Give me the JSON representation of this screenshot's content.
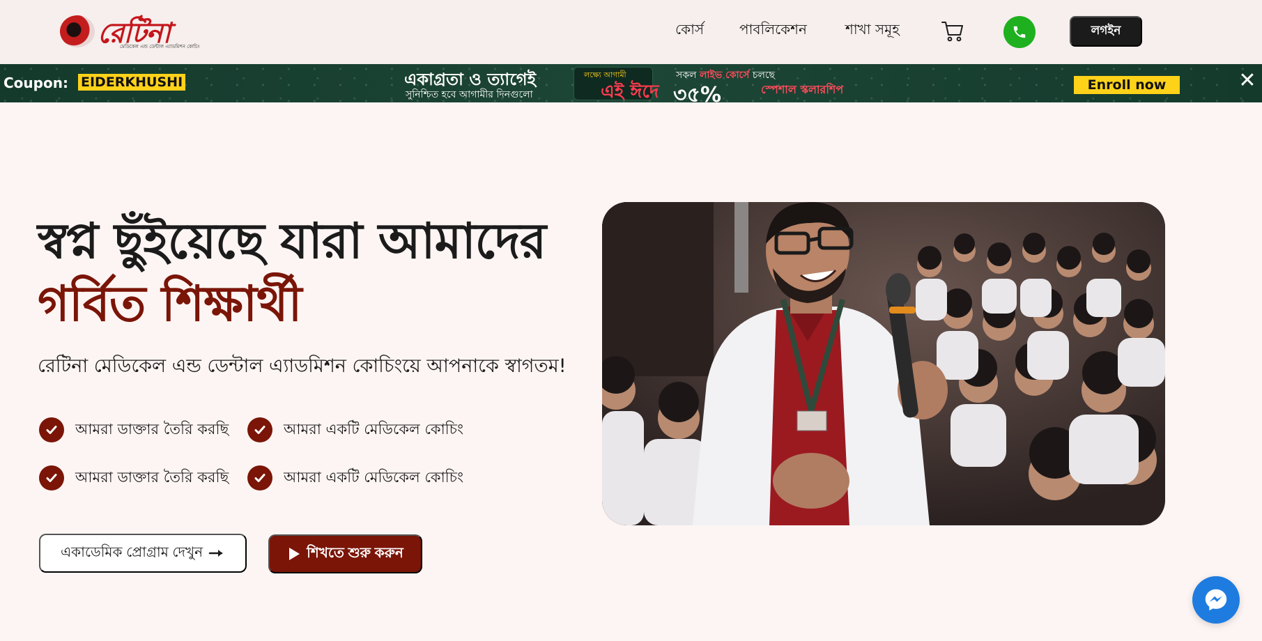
{
  "header": {
    "logo_text": "রেটিনা",
    "logo_subtitle": "মেডিকেল এন্ড ডেন্টাল এ্যাডমিশন কোচিং",
    "nav": [
      "কোর্স",
      "পাবলিকেশন",
      "শাখা সমূহ"
    ],
    "login_label": "লগইন"
  },
  "banner": {
    "coupon_label": "Coupon:",
    "coupon_code": "EIDERKHUSHI",
    "headline": "একাগ্রতা ও ত্যাগেই",
    "subheadline": "সুনিশ্চিত হবে আগামীর দিনগুলো",
    "eid_small": "লক্ষ্যে আগামী",
    "eid_big": "এই ঈদে",
    "live_text_pre": "সকল ",
    "live_text_hl": "লাইভ কোর্সে",
    "live_text_post": " চলছে",
    "discount": "৩৫%",
    "scholarship": "স্পেশাল স্কলারশিপ",
    "enroll_label": "Enroll now",
    "close_symbol": "✕"
  },
  "hero": {
    "title_line1": "স্বপ্ন ছুঁইয়েছে যারা আমাদের",
    "title_line2": "গর্বিত শিক্ষার্থী",
    "welcome": "রেটিনা মেডিকেল এন্ড ডেন্টাল এ্যাডমিশন কোচিংয়ে আপনাকে স্বাগতম!",
    "features": [
      "আমরা ডাক্তার তৈরি করছি",
      "আমরা একটি মেডিকেল কোচিং",
      "আমরা ডাক্তার তৈরি করছি",
      "আমরা একটি মেডিকেল কোচিং"
    ],
    "btn_academic": "একাডেমিক প্রোগ্রাম দেখুন",
    "btn_start": "শিখতে শুরু করুন"
  },
  "colors": {
    "brand_red": "#c4161c",
    "accent_maroon": "#7a1508",
    "phone_green": "#1fb01f",
    "banner_green": "#1d4636",
    "coupon_yellow": "#ffd21a",
    "messenger_blue": "#1e7ce0"
  },
  "icons": [
    "cart-icon",
    "phone-icon",
    "close-icon",
    "check-icon",
    "arrow-right-icon",
    "play-icon",
    "messenger-icon"
  ]
}
